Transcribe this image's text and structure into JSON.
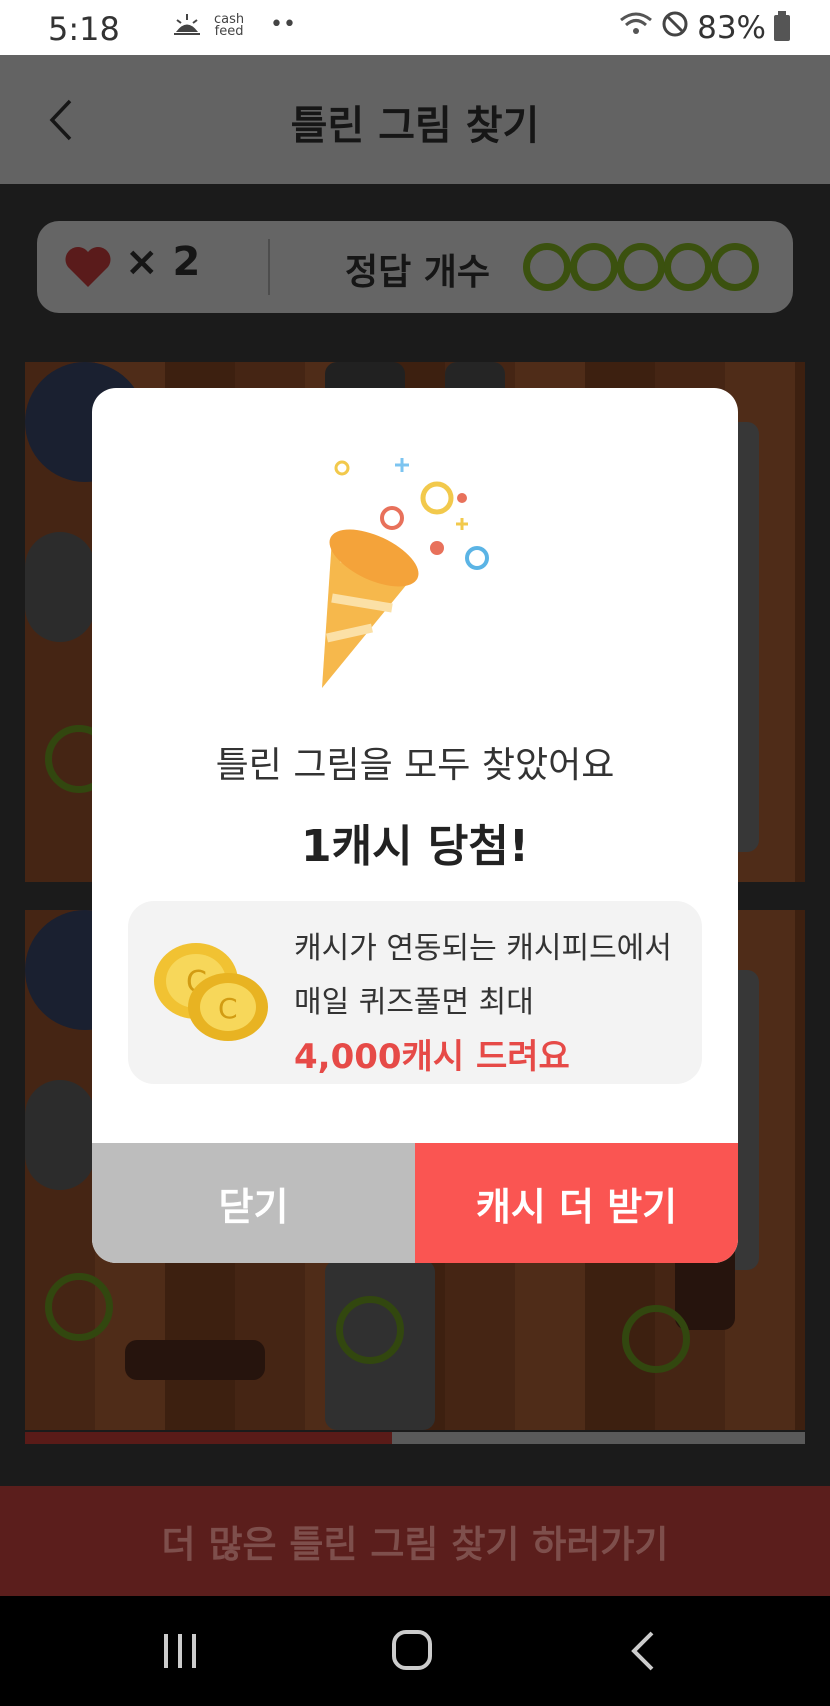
{
  "status": {
    "time": "5:18",
    "app1": "cash",
    "app2": "feed",
    "dots": "••",
    "battery": "83%"
  },
  "header": {
    "title": "틀린 그림 찾기"
  },
  "score": {
    "lives": "× 2",
    "answers_label": "정답 개수",
    "answers_total": 5
  },
  "progress": {
    "fraction": 0.47
  },
  "bottom_cta": "더 많은 틀린 그림 찾기 하러가기",
  "modal": {
    "message": "틀린 그림을 모두 찾았어요",
    "prize": "1캐시 당첨!",
    "promo_line1": "캐시가 연동되는 캐시피드에서",
    "promo_line2": "매일 퀴즈풀면 최대",
    "promo_line3": "4,000캐시 드려요",
    "close_label": "닫기",
    "more_label": "캐시 더 받기"
  },
  "colors": {
    "accent": "#fa5552",
    "dot": "#5b7d17",
    "promo_text": "#e64a47"
  }
}
